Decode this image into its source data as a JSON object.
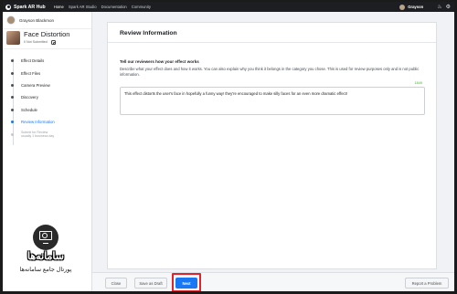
{
  "topbar": {
    "brand": "Spark AR Hub",
    "nav": [
      "Home",
      "Spark AR Studio",
      "Documentation",
      "Community"
    ],
    "user_name": "Grayson",
    "icons": [
      "bell-icon",
      "gear-icon"
    ]
  },
  "sidebar": {
    "user_name": "Grayson Blackmon",
    "effect": {
      "title": "Face Distortion",
      "status": "0 Not Submitted"
    },
    "steps": [
      {
        "label": "Effect Details",
        "state": "done"
      },
      {
        "label": "Effect Files",
        "state": "done"
      },
      {
        "label": "Camera Preview",
        "state": "done"
      },
      {
        "label": "Discovery",
        "state": "done"
      },
      {
        "label": "Schedule",
        "state": "done"
      },
      {
        "label": "Review Information",
        "state": "active"
      },
      {
        "label": "Submit for Review",
        "sub": "usually 1 business day",
        "state": "pending"
      }
    ]
  },
  "main": {
    "title": "Review Information",
    "section_heading": "Tell our reviewers how your effect works",
    "section_description": "Describe what your effect does and how it works. You can also explain why you think it belongs in the category you chose. This is used for review purposes only and is not public information.",
    "char_count": "1849",
    "textarea_value": "This effect distorts the user's face in hopefully a funny way! they're encouraged to make silly faces for an even more dramatic effect!"
  },
  "footer": {
    "close_label": "Close",
    "draft_label": "Save as Draft",
    "next_label": "Next",
    "report_label": "Report a Problem"
  },
  "watermark": {
    "title": "سامانه‌ها",
    "subtitle": "پورتال جامع سامانه‌ها"
  },
  "colors": {
    "accent": "#1877f2",
    "highlight": "#e0242d",
    "topbar": "#1c1e21"
  }
}
